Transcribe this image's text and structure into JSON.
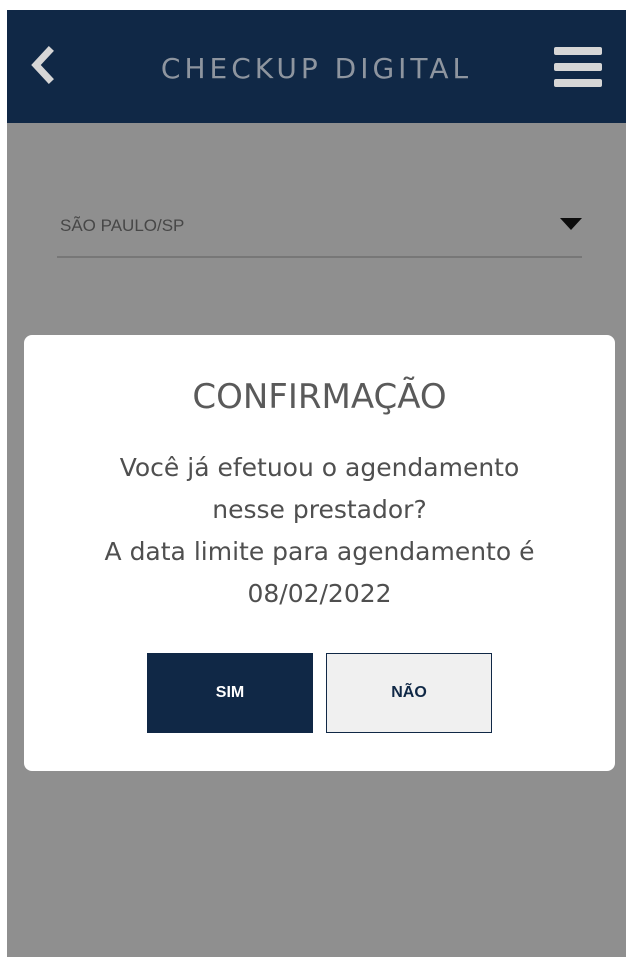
{
  "header": {
    "title": "CHECKUP DIGITAL",
    "back_icon": "chevron-left-icon",
    "menu_icon": "hamburger-menu-icon"
  },
  "city_select": {
    "value": "SÃO PAULO/SP",
    "arrow_icon": "caret-down-icon"
  },
  "dialog": {
    "title": "CONFIRMAÇÃO",
    "message_lines": [
      "Você já efetuou o agendamento",
      "nesse prestador?",
      "A data limite para agendamento é",
      "08/02/2022"
    ],
    "yes_label": "SIM",
    "no_label": "NÃO"
  },
  "colors": {
    "header_bg": "#102846",
    "overlay": "#8f8f8f",
    "primary_button": "#102846",
    "secondary_button": "#f0f0f0"
  }
}
